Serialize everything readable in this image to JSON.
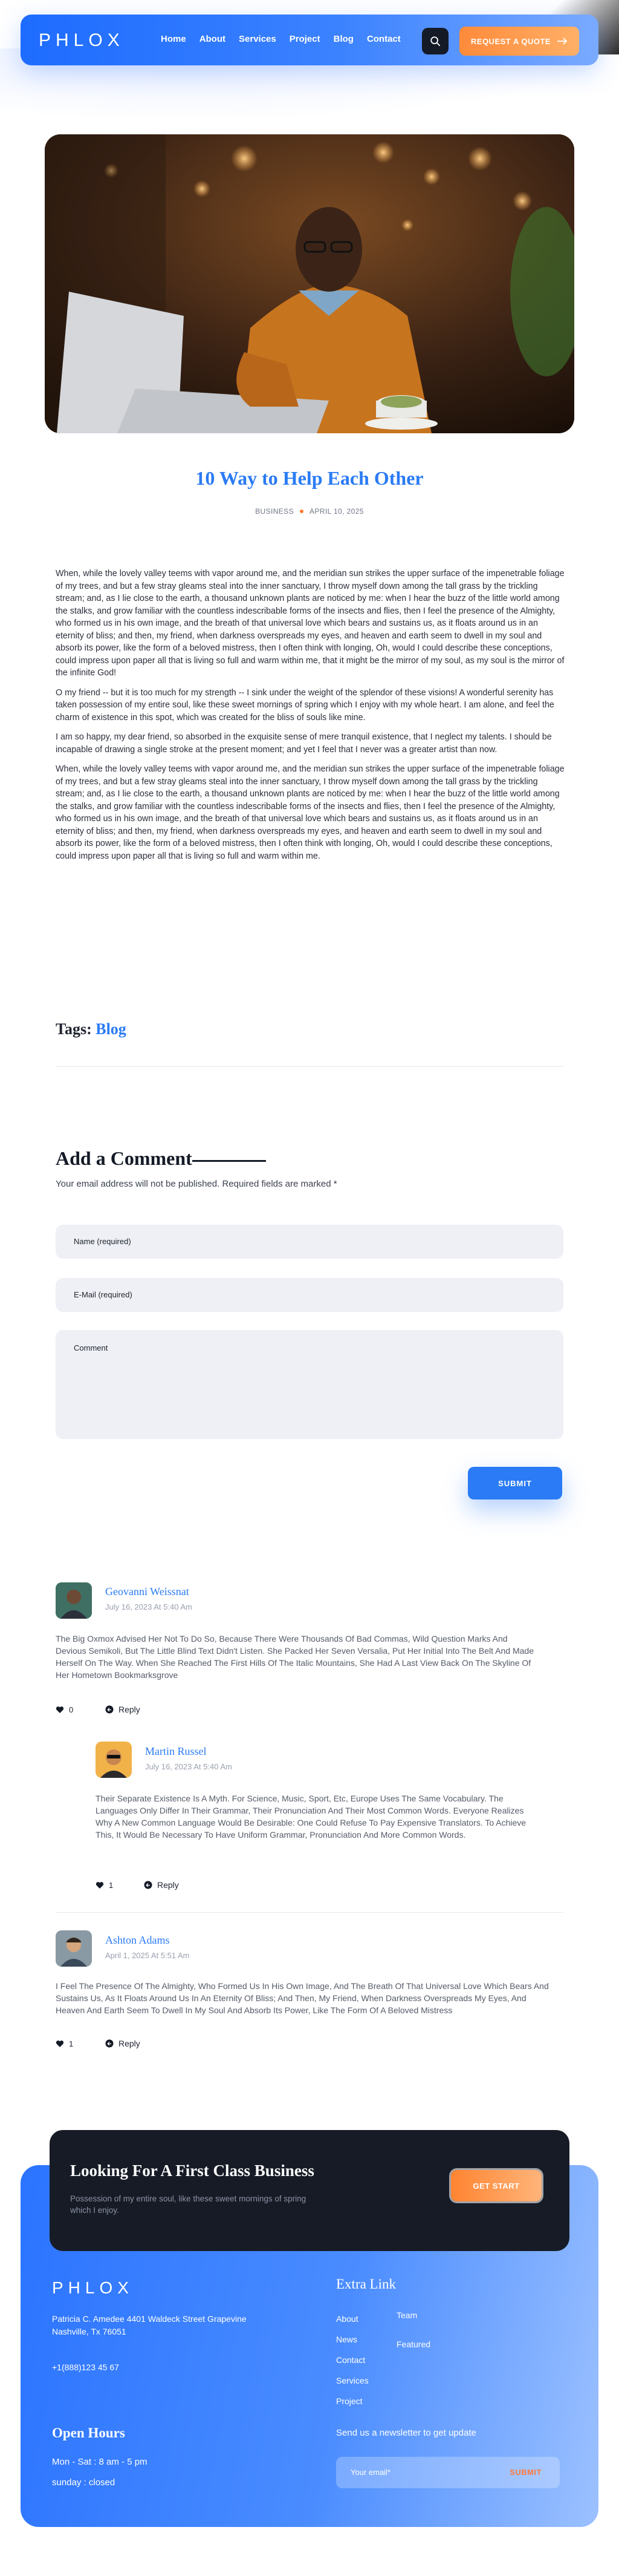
{
  "header": {
    "logo": "PHLOX",
    "nav": [
      "Home",
      "About",
      "Services",
      "Project",
      "Blog",
      "Contact"
    ],
    "quote_label": "REQUEST A QUOTE",
    "colors": {
      "brand": "#2a7bf5",
      "accent": "#ff8a3a",
      "dark": "#141a26"
    }
  },
  "post": {
    "title": "10 Way to Help Each Other",
    "category": "BUSINESS",
    "date": "APRIL 10, 2025",
    "paragraphs": [
      "When, while the lovely valley teems with vapor around me, and the meridian sun strikes the upper surface of the impenetrable foliage of my trees, and but a few stray gleams steal into the inner sanctuary, I throw myself down among the tall grass by the trickling stream; and, as I lie close to the earth, a thousand unknown plants are noticed by me: when I hear the buzz of the little world among the stalks, and grow familiar with the countless indescribable forms of the insects and flies, then I feel the presence of the Almighty, who formed us in his own image, and the breath of that universal love which bears and sustains us, as it floats around us in an eternity of bliss; and then, my friend, when darkness overspreads my eyes, and heaven and earth seem to dwell in my soul and absorb its power, like the form of a beloved mistress, then I often think with longing, Oh, would I could describe these conceptions, could impress upon paper all that is living so full and warm within me, that it might be the mirror of my soul, as my soul is the mirror of the infinite God!",
      "O my friend -- but it is too much for my strength -- I sink under the weight of the splendor of these visions! A wonderful serenity has taken possession of my entire soul, like these sweet mornings of spring which I enjoy with my whole heart. I am alone, and feel the charm of existence in this spot, which was created for the bliss of souls like mine.",
      "I am so happy, my dear friend, so absorbed in the exquisite sense of mere tranquil existence, that I neglect my talents. I should be incapable of drawing a single stroke at the present moment; and yet I feel that I never was a greater artist than now.",
      "When, while the lovely valley teems with vapor around me, and the meridian sun strikes the upper surface of the impenetrable foliage of my trees, and but a few stray gleams steal into the inner sanctuary, I throw myself down among the tall grass by the trickling stream; and, as I lie close to the earth, a thousand unknown plants are noticed by me: when I hear the buzz of the little world among the stalks, and grow familiar with the countless indescribable forms of the insects and flies, then I feel the presence of the Almighty, who formed us in his own image, and the breath of that universal love which bears and sustains us, as it floats around us in an eternity of bliss; and then, my friend, when darkness overspreads my eyes, and heaven and earth seem to dwell in my soul and absorb its power, like the form of a beloved mistress, then I often think with longing, Oh, would I could describe these conceptions, could impress upon paper all that is living so full and warm within me."
    ],
    "tags_label": "Tags:",
    "tag": "Blog"
  },
  "comment_form": {
    "heading": "Add a Comment",
    "note": "Your email address will not be published. Required fields are marked *",
    "name_placeholder": "Name (required)",
    "email_placeholder": "E-Mail (required)",
    "comment_placeholder": "Comment",
    "submit_label": "SUBMIT"
  },
  "comments": [
    {
      "name": "Geovanni Weissnat",
      "date": "July 16, 2023 At 5:40 Am",
      "text": "The Big Oxmox Advised Her Not To Do So, Because There Were Thousands Of Bad Commas, Wild Question Marks And Devious Semikoli, But The Little Blind Text Didn't Listen. She Packed Her Seven Versalia, Put Her Initial Into The Belt And Made Herself On The Way. When She Reached The First Hills Of The Italic Mountains, She Had A Last View Back On The Skyline Of Her Hometown Bookmarksgrove",
      "likes": "0",
      "reply": "Reply"
    },
    {
      "name": "Martin Russel",
      "date": "July 16, 2023 At 5:40 Am",
      "text": "Their Separate Existence Is A Myth. For Science, Music, Sport, Etc, Europe Uses The Same Vocabulary. The Languages Only Differ In Their Grammar, Their Pronunciation And Their Most Common Words. Everyone Realizes Why A New Common Language Would Be Desirable: One Could Refuse To Pay Expensive Translators. To Achieve This, It Would Be Necessary To Have Uniform Grammar, Pronunciation And More Common Words.",
      "likes": "1",
      "reply": "Reply"
    },
    {
      "name": "Ashton Adams",
      "date": "April 1, 2025 At 5:51 Am",
      "text": "I Feel The Presence Of The Almighty, Who Formed Us In His Own Image, And The Breath Of That Universal Love Which Bears And Sustains Us, As It Floats Around Us In An Eternity Of Bliss; And Then, My Friend, When Darkness Overspreads My Eyes, And Heaven And Earth Seem To Dwell In My Soul And Absorb Its Power, Like The Form Of A Beloved Mistress",
      "likes": "1",
      "reply": "Reply"
    }
  ],
  "cta": {
    "heading": "Looking For A First Class Business",
    "text": "Possession of my entire soul, like these sweet mornings of spring which I enjoy.",
    "button": "GET START"
  },
  "footer": {
    "logo": "PHLOX",
    "address": "Patricia C. Amedee 4401 Waldeck Street Grapevine Nashville, Tx 76051",
    "phone": "+1(888)123 45 67",
    "open_hours_title": "Open Hours",
    "hours": [
      "Mon - Sat : 8 am - 5 pm",
      "sunday : closed"
    ],
    "extra_title": "Extra Link",
    "links_col1": [
      "About",
      "News",
      "Contact",
      "Services",
      "Project"
    ],
    "links_col2": [
      "Team",
      "Featured"
    ],
    "newsletter_text": "Send us a newsletter to get update",
    "email_placeholder": "Your email*",
    "subscribe": "SUBMIT"
  }
}
